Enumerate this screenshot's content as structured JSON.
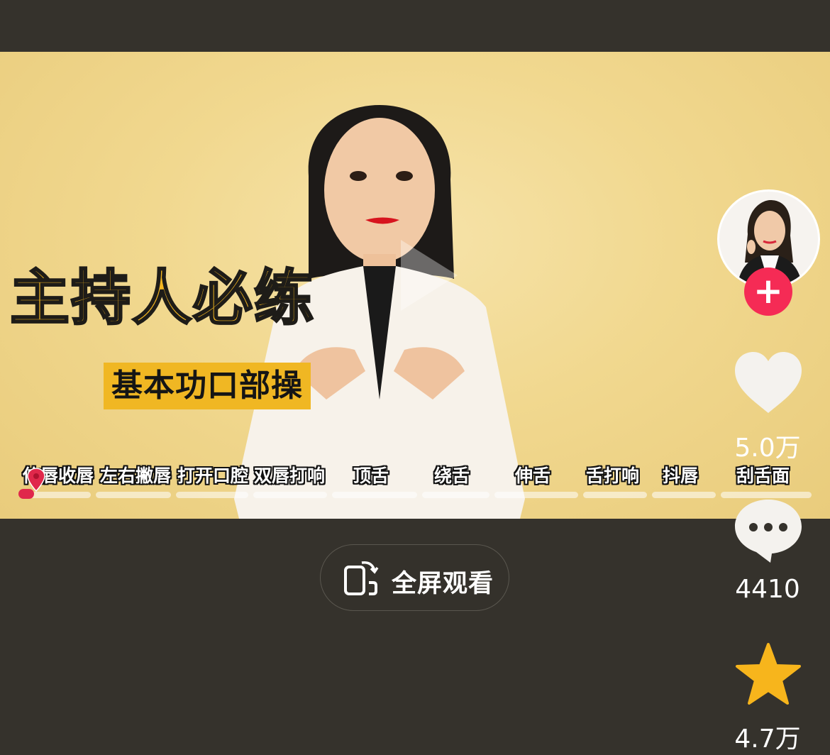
{
  "video": {
    "title_main": "主持人必练",
    "title_sub": "基本功口部操",
    "chapters": [
      "伸唇收唇",
      "左右撇唇",
      "打开口腔",
      "双唇打响",
      "顶舌",
      "绕舌",
      "伸舌",
      "舌打响",
      "抖唇",
      "刮舌面"
    ],
    "progress": 0.0
  },
  "fullscreen_button": {
    "label": "全屏观看"
  },
  "sidebar": {
    "follow_icon": "plus-icon",
    "likes": "5.0万",
    "comments": "4410",
    "favorites": "4.7万"
  },
  "colors": {
    "accent": "#f52b55",
    "title_yellow": "#f4b620",
    "star": "#f7b51c",
    "background": "#35322c"
  }
}
